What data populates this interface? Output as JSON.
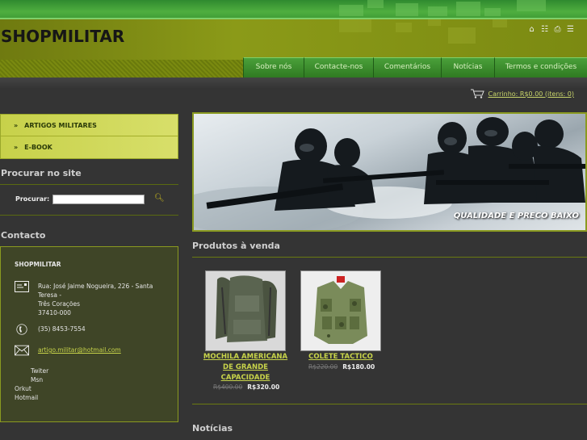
{
  "header": {
    "site_title": "SHOPMILITAR",
    "top_icons": [
      "home-icon",
      "sitemap-icon",
      "print-icon",
      "rss-icon"
    ]
  },
  "nav": {
    "items": [
      "Sobre nós",
      "Contacte-nos",
      "Comentários",
      "Notícias",
      "Termos e condições"
    ]
  },
  "cart": {
    "label": "Carrinho: R$0.00 (itens: 0)"
  },
  "sidebar": {
    "categories": [
      "ARTIGOS MILITARES",
      "E-BOOK"
    ],
    "search": {
      "heading": "Procurar no site",
      "label": "Procurar:",
      "value": ""
    },
    "contact": {
      "heading": "Contacto",
      "name": "SHOPMILITAR",
      "address_line1": "Rua: José Jaime Nogueira, 226 - Santa",
      "address_line2": "Teresa -",
      "address_line3": "Três Corações",
      "address_line4": "37410-000",
      "phone": "(35) 8453-7554",
      "email": "artigo.militar@hotmail.com",
      "social": [
        "Twiter",
        "Msn",
        "Orkut",
        "Hotmail"
      ]
    }
  },
  "banner": {
    "caption": "QUALIDADE E PRECO BAIXO"
  },
  "products": {
    "heading": "Produtos à venda",
    "items": [
      {
        "name_line1": "MOCHILA AMERICANA",
        "name_line2": "DE GRANDE",
        "name_line3": "CAPACIDADE",
        "old_price": "R$400.00",
        "price": "R$320.00"
      },
      {
        "name_line1": "COLETE TACTICO",
        "old_price": "R$220.00",
        "price": "R$180.00"
      }
    ]
  },
  "news": {
    "heading": "Notícias"
  },
  "colors": {
    "accent_green": "#4aa03a",
    "olive": "#8b9a18",
    "link_yellow": "#c8d44a",
    "background": "#343434"
  }
}
